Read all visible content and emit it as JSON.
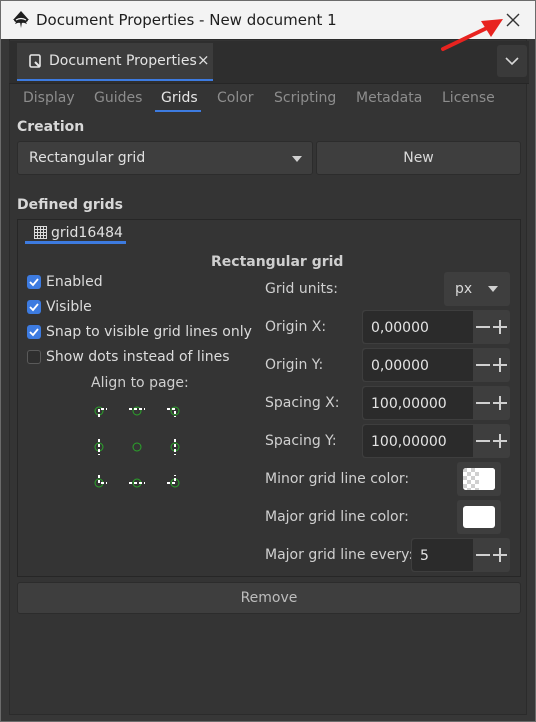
{
  "window": {
    "title": "Document Properties - New document 1"
  },
  "dock": {
    "tab_label": "Document Properties",
    "tab_close": "×"
  },
  "subtabs": [
    "Display",
    "Guides",
    "Grids",
    "Color",
    "Scripting",
    "Metadata",
    "License"
  ],
  "active_subtab": "Grids",
  "creation": {
    "section_label": "Creation",
    "grid_type": "Rectangular grid",
    "new_button": "New"
  },
  "defined": {
    "section_label": "Defined grids",
    "grid_tab": "grid16484"
  },
  "grid": {
    "heading": "Rectangular grid",
    "options": {
      "enabled": {
        "label": "Enabled",
        "checked": true
      },
      "visible": {
        "label": "Visible",
        "checked": true
      },
      "snap": {
        "label": "Snap to visible grid lines only",
        "checked": true
      },
      "dots": {
        "label": "Show dots instead of lines",
        "checked": false
      }
    },
    "align_label": "Align to page:",
    "units": {
      "label": "Grid units:",
      "value": "px"
    },
    "origin_x": {
      "label": "Origin X:",
      "value": "0,00000"
    },
    "origin_y": {
      "label": "Origin Y:",
      "value": "0,00000"
    },
    "spacing_x": {
      "label": "Spacing X:",
      "value": "100,00000"
    },
    "spacing_y": {
      "label": "Spacing Y:",
      "value": "100,00000"
    },
    "minor_color": {
      "label": "Minor grid line color:",
      "color": "#ffffff"
    },
    "major_color": {
      "label": "Major grid line color:",
      "color": "#ffffff"
    },
    "major_every": {
      "label": "Major grid line every:",
      "value": "5"
    },
    "remove_button": "Remove"
  },
  "colors": {
    "accent": "#3d7be0",
    "background": "#373737",
    "annotation_arrow": "#e8231f",
    "align_marker": "#2aa52a"
  }
}
